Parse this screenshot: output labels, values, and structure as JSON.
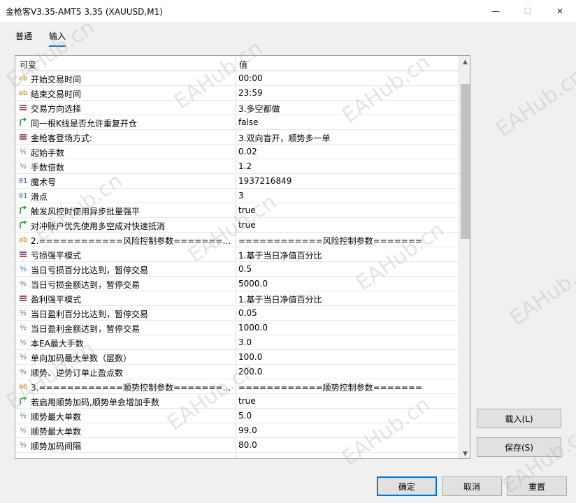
{
  "window": {
    "title": "金枪客V3.35-AMT5 3.35 (XAUUSD,M1)",
    "minimize_glyph": "—",
    "maximize_glyph": "☐",
    "close_glyph": "✕"
  },
  "tabs": [
    {
      "label": "普通",
      "active": false
    },
    {
      "label": "输入",
      "active": true
    }
  ],
  "table": {
    "headers": {
      "name": "可变",
      "value": "值"
    },
    "rows": [
      {
        "icon": "ab",
        "name": "开始交易时间",
        "value": "00:00"
      },
      {
        "icon": "ab",
        "name": "结束交易时间",
        "value": "23:59"
      },
      {
        "icon": "enum",
        "name": "交易方向选择",
        "value": "3.多空都做"
      },
      {
        "icon": "bool",
        "name": "同一根K线是否允许重复开仓",
        "value": "false"
      },
      {
        "icon": "enum",
        "name": "金枪客登场方式:",
        "value": "3.双向盲开，顺势多一单"
      },
      {
        "icon": "half",
        "name": "起始手数",
        "value": "0.02"
      },
      {
        "icon": "half",
        "name": "手数倍数",
        "value": "1.2"
      },
      {
        "icon": "01",
        "name": "魔术号",
        "value": "1937216849"
      },
      {
        "icon": "01",
        "name": "滑点",
        "value": "3"
      },
      {
        "icon": "bool",
        "name": "触发风控时使用异步批量强平",
        "value": "true"
      },
      {
        "icon": "bool",
        "name": "对冲账户优先使用多空成对快速抵消",
        "value": "true"
      },
      {
        "icon": "ab",
        "name": "2.============风险控制参数===========...",
        "value": "============风险控制参数======="
      },
      {
        "icon": "enum",
        "name": "亏损强平模式",
        "value": "1.基于当日净值百分比"
      },
      {
        "icon": "half",
        "name": "当日亏损百分比达到，暂停交易",
        "value": "0.5"
      },
      {
        "icon": "half",
        "name": "当日亏损金额达到，暂停交易",
        "value": "5000.0"
      },
      {
        "icon": "enum",
        "name": "盈利强平模式",
        "value": "1.基于当日净值百分比"
      },
      {
        "icon": "half",
        "name": "当日盈利百分比达到，暂停交易",
        "value": "0.05"
      },
      {
        "icon": "half",
        "name": "当日盈利金额达到，暂停交易",
        "value": "1000.0"
      },
      {
        "icon": "half",
        "name": "本EA最大手数",
        "value": "3.0"
      },
      {
        "icon": "half",
        "name": "单向加码最大单数（层数）",
        "value": "100.0"
      },
      {
        "icon": "half",
        "name": "顺势、逆势订单止盈点数",
        "value": "200.0"
      },
      {
        "icon": "ab",
        "name": "3.============顺势控制参数===========...",
        "value": "============顺势控制参数======="
      },
      {
        "icon": "bool",
        "name": "若启用顺势加码,顺势单会增加手数",
        "value": "true"
      },
      {
        "icon": "half",
        "name": "顺势最大单数",
        "value": "5.0"
      },
      {
        "icon": "half",
        "name": "顺势最大单数",
        "value": "99.0"
      },
      {
        "icon": "half",
        "name": "顺势加码间隔",
        "value": "80.0"
      }
    ],
    "scroll_up_glyph": "▲",
    "scroll_down_glyph": "▼"
  },
  "buttons": {
    "load": "载入(L)",
    "save": "保存(S)",
    "ok": "确定",
    "cancel": "取消",
    "reset": "重置"
  },
  "watermark": "EAHub.cn",
  "colors": {
    "accent": "#0078d7",
    "enum_icon": "#d04040",
    "bool_icon": "#2a9a3a",
    "scroll_thumb": "#c2c2c2"
  }
}
